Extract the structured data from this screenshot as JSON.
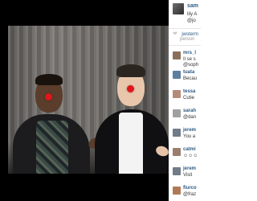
{
  "post": {
    "author": "sam",
    "caption": "lily A",
    "caption_2": "@jo"
  },
  "likes": {
    "text": "jwsterm",
    "sub": "person"
  },
  "comments": [
    {
      "user": "mrs_l",
      "text": "Il se s",
      "text_2": "@soph",
      "color": "#8c6f5a"
    },
    {
      "user": "tuata",
      "text": "Becau",
      "color": "#5e7fa0"
    },
    {
      "user": "tessa",
      "text": "Cutie",
      "color": "#b48a7a"
    },
    {
      "user": "sarah",
      "text": "@dan",
      "color": "#a0a0a0"
    },
    {
      "user": "jerem",
      "text": "You a",
      "color": "#707c88"
    },
    {
      "user": "catmi",
      "text": "",
      "color": "#9a7e70"
    },
    {
      "user": "jerem",
      "text": "Visit",
      "color": "#707c88"
    },
    {
      "user": "flurco",
      "text": "@fraz",
      "color": "#b07a56"
    }
  ],
  "icons": {
    "like": "heart-icon",
    "comment_emoji": "emoji-icon"
  }
}
